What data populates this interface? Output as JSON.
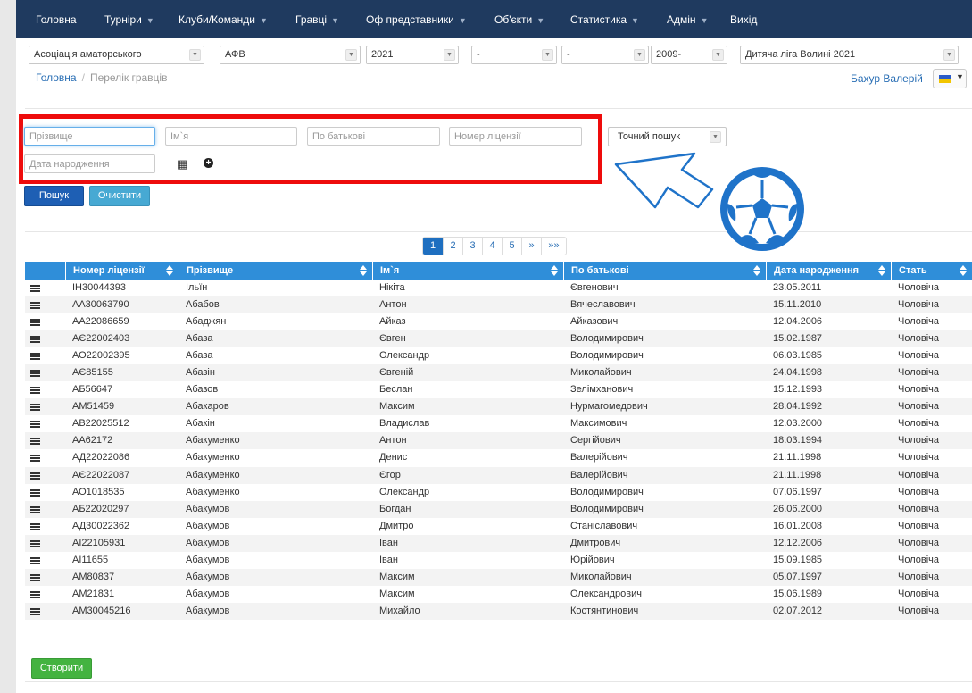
{
  "nav": [
    {
      "label": "Головна",
      "caret": false
    },
    {
      "label": "Турніри",
      "caret": true
    },
    {
      "label": "Клуби/Команди",
      "caret": true
    },
    {
      "label": "Гравці",
      "caret": true
    },
    {
      "label": "Оф представники",
      "caret": true
    },
    {
      "label": "Об'єкти",
      "caret": true
    },
    {
      "label": "Статистика",
      "caret": true
    },
    {
      "label": "Адмін",
      "caret": true
    },
    {
      "label": "Вихід",
      "caret": false
    }
  ],
  "filters": {
    "association": "Асоціація аматорського",
    "federation": "АФВ",
    "season": "2021",
    "filter4": "-",
    "filter5": "-",
    "birth_year": "2009-",
    "league": "Дитяча ліга Волині 2021"
  },
  "breadcrumb": {
    "home": "Головна",
    "separator": "/",
    "current": "Перелік гравців"
  },
  "user": {
    "name": "Бахур Валерій"
  },
  "search": {
    "surname_placeholder": "Прізвище",
    "name_placeholder": "Ім`я",
    "patronymic_placeholder": "По батькові",
    "license_placeholder": "Номер ліцензії",
    "exact_search": "Точний пошук",
    "birthdate_placeholder": "Дата народження",
    "search_button": "Пошук",
    "clear_button": "Очистити"
  },
  "pagination": [
    "1",
    "2",
    "3",
    "4",
    "5",
    "»",
    "»»"
  ],
  "table": {
    "columns": [
      "Номер ліцензії",
      "Прізвище",
      "Ім`я",
      "По батькові",
      "Дата народження",
      "Стать"
    ],
    "rows": [
      [
        "ІН30044393",
        "Ільїн",
        "Нікіта",
        "Євгенович",
        "23.05.2011",
        "Чоловіча"
      ],
      [
        "АА30063790",
        "Абабов",
        "Антон",
        "Вячеславович",
        "15.11.2010",
        "Чоловіча"
      ],
      [
        "АА22086659",
        "Абаджян",
        "Айказ",
        "Айказович",
        "12.04.2006",
        "Чоловіча"
      ],
      [
        "АЄ22002403",
        "Абаза",
        "Євген",
        "Володимирович",
        "15.02.1987",
        "Чоловіча"
      ],
      [
        "АО22002395",
        "Абаза",
        "Олександр",
        "Володимирович",
        "06.03.1985",
        "Чоловіча"
      ],
      [
        "АЄ85155",
        "Абазін",
        "Євгеній",
        "Миколайович",
        "24.04.1998",
        "Чоловіча"
      ],
      [
        "АБ56647",
        "Абазов",
        "Беслан",
        "Зелімханович",
        "15.12.1993",
        "Чоловіча"
      ],
      [
        "АМ51459",
        "Абакаров",
        "Максим",
        "Нурмагомедович",
        "28.04.1992",
        "Чоловіча"
      ],
      [
        "АВ22025512",
        "Абакін",
        "Владислав",
        "Максимович",
        "12.03.2000",
        "Чоловіча"
      ],
      [
        "АА62172",
        "Абакуменко",
        "Антон",
        "Сергійович",
        "18.03.1994",
        "Чоловіча"
      ],
      [
        "АД22022086",
        "Абакуменко",
        "Денис",
        "Валерійович",
        "21.11.1998",
        "Чоловіча"
      ],
      [
        "АЄ22022087",
        "Абакуменко",
        "Єгор",
        "Валерійович",
        "21.11.1998",
        "Чоловіча"
      ],
      [
        "АО1018535",
        "Абакуменко",
        "Олександр",
        "Володимирович",
        "07.06.1997",
        "Чоловіча"
      ],
      [
        "АБ22020297",
        "Абакумов",
        "Богдан",
        "Володимирович",
        "26.06.2000",
        "Чоловіча"
      ],
      [
        "АД30022362",
        "Абакумов",
        "Дмитро",
        "Станіславович",
        "16.01.2008",
        "Чоловіча"
      ],
      [
        "АІ22105931",
        "Абакумов",
        "Іван",
        "Дмитрович",
        "12.12.2006",
        "Чоловіча"
      ],
      [
        "АІ11655",
        "Абакумов",
        "Іван",
        "Юрійович",
        "15.09.1985",
        "Чоловіча"
      ],
      [
        "АМ80837",
        "Абакумов",
        "Максим",
        "Миколайович",
        "05.07.1997",
        "Чоловіча"
      ],
      [
        "АМ21831",
        "Абакумов",
        "Максим",
        "Олександрович",
        "15.06.1989",
        "Чоловіча"
      ],
      [
        "АМ30045216",
        "Абакумов",
        "Михайло",
        "Костянтинович",
        "02.07.2012",
        "Чоловіча"
      ]
    ]
  },
  "create_button": "Створити",
  "colors": {
    "navbar": "#1f3a5f",
    "table_header": "#2f8ed9",
    "highlight_box": "#ee0c0c",
    "annotation_blue": "#1f73c9",
    "create_button": "#44b340"
  },
  "icons": {
    "calendar": "calendar-grid-icon",
    "add": "plus-circle-icon",
    "row_menu": "hamburger-icon",
    "sort": "sort-arrows-icon",
    "decoration_ball": "soccer-ball-icon",
    "decoration_arrow": "pointer-arrow-icon"
  }
}
